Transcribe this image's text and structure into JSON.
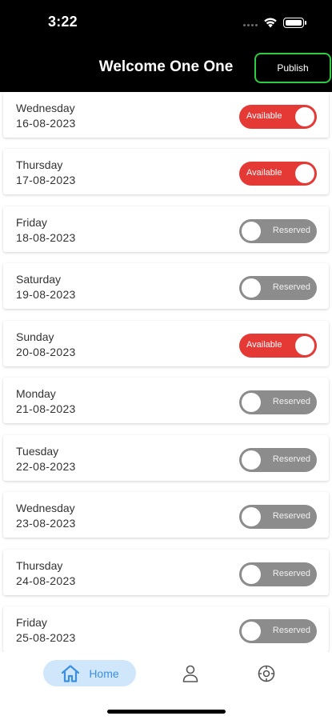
{
  "status_bar": {
    "time": "3:22"
  },
  "header": {
    "title": "Welcome One One",
    "publish_label": "Publish"
  },
  "days": [
    {
      "day": "Wednesday",
      "date": "16-08-2023",
      "status": "Available"
    },
    {
      "day": "Thursday",
      "date": "17-08-2023",
      "status": "Available"
    },
    {
      "day": "Friday",
      "date": "18-08-2023",
      "status": "Reserved"
    },
    {
      "day": "Saturday",
      "date": "19-08-2023",
      "status": "Reserved"
    },
    {
      "day": "Sunday",
      "date": "20-08-2023",
      "status": "Available"
    },
    {
      "day": "Monday",
      "date": "21-08-2023",
      "status": "Reserved"
    },
    {
      "day": "Tuesday",
      "date": "22-08-2023",
      "status": "Reserved"
    },
    {
      "day": "Wednesday",
      "date": "23-08-2023",
      "status": "Reserved"
    },
    {
      "day": "Thursday",
      "date": "24-08-2023",
      "status": "Reserved"
    },
    {
      "day": "Friday",
      "date": "25-08-2023",
      "status": "Reserved"
    }
  ],
  "tabbar": {
    "home_label": "Home",
    "home_icon": "home-icon",
    "profile_icon": "person-icon",
    "settings_icon": "settings-gear-icon"
  },
  "colors": {
    "available": "#e53935",
    "reserved": "#8c8c8c",
    "publish_border": "#2ecc40",
    "home_tab_bg": "#cfe6fb",
    "home_tab_accent": "#3b8fe0"
  }
}
